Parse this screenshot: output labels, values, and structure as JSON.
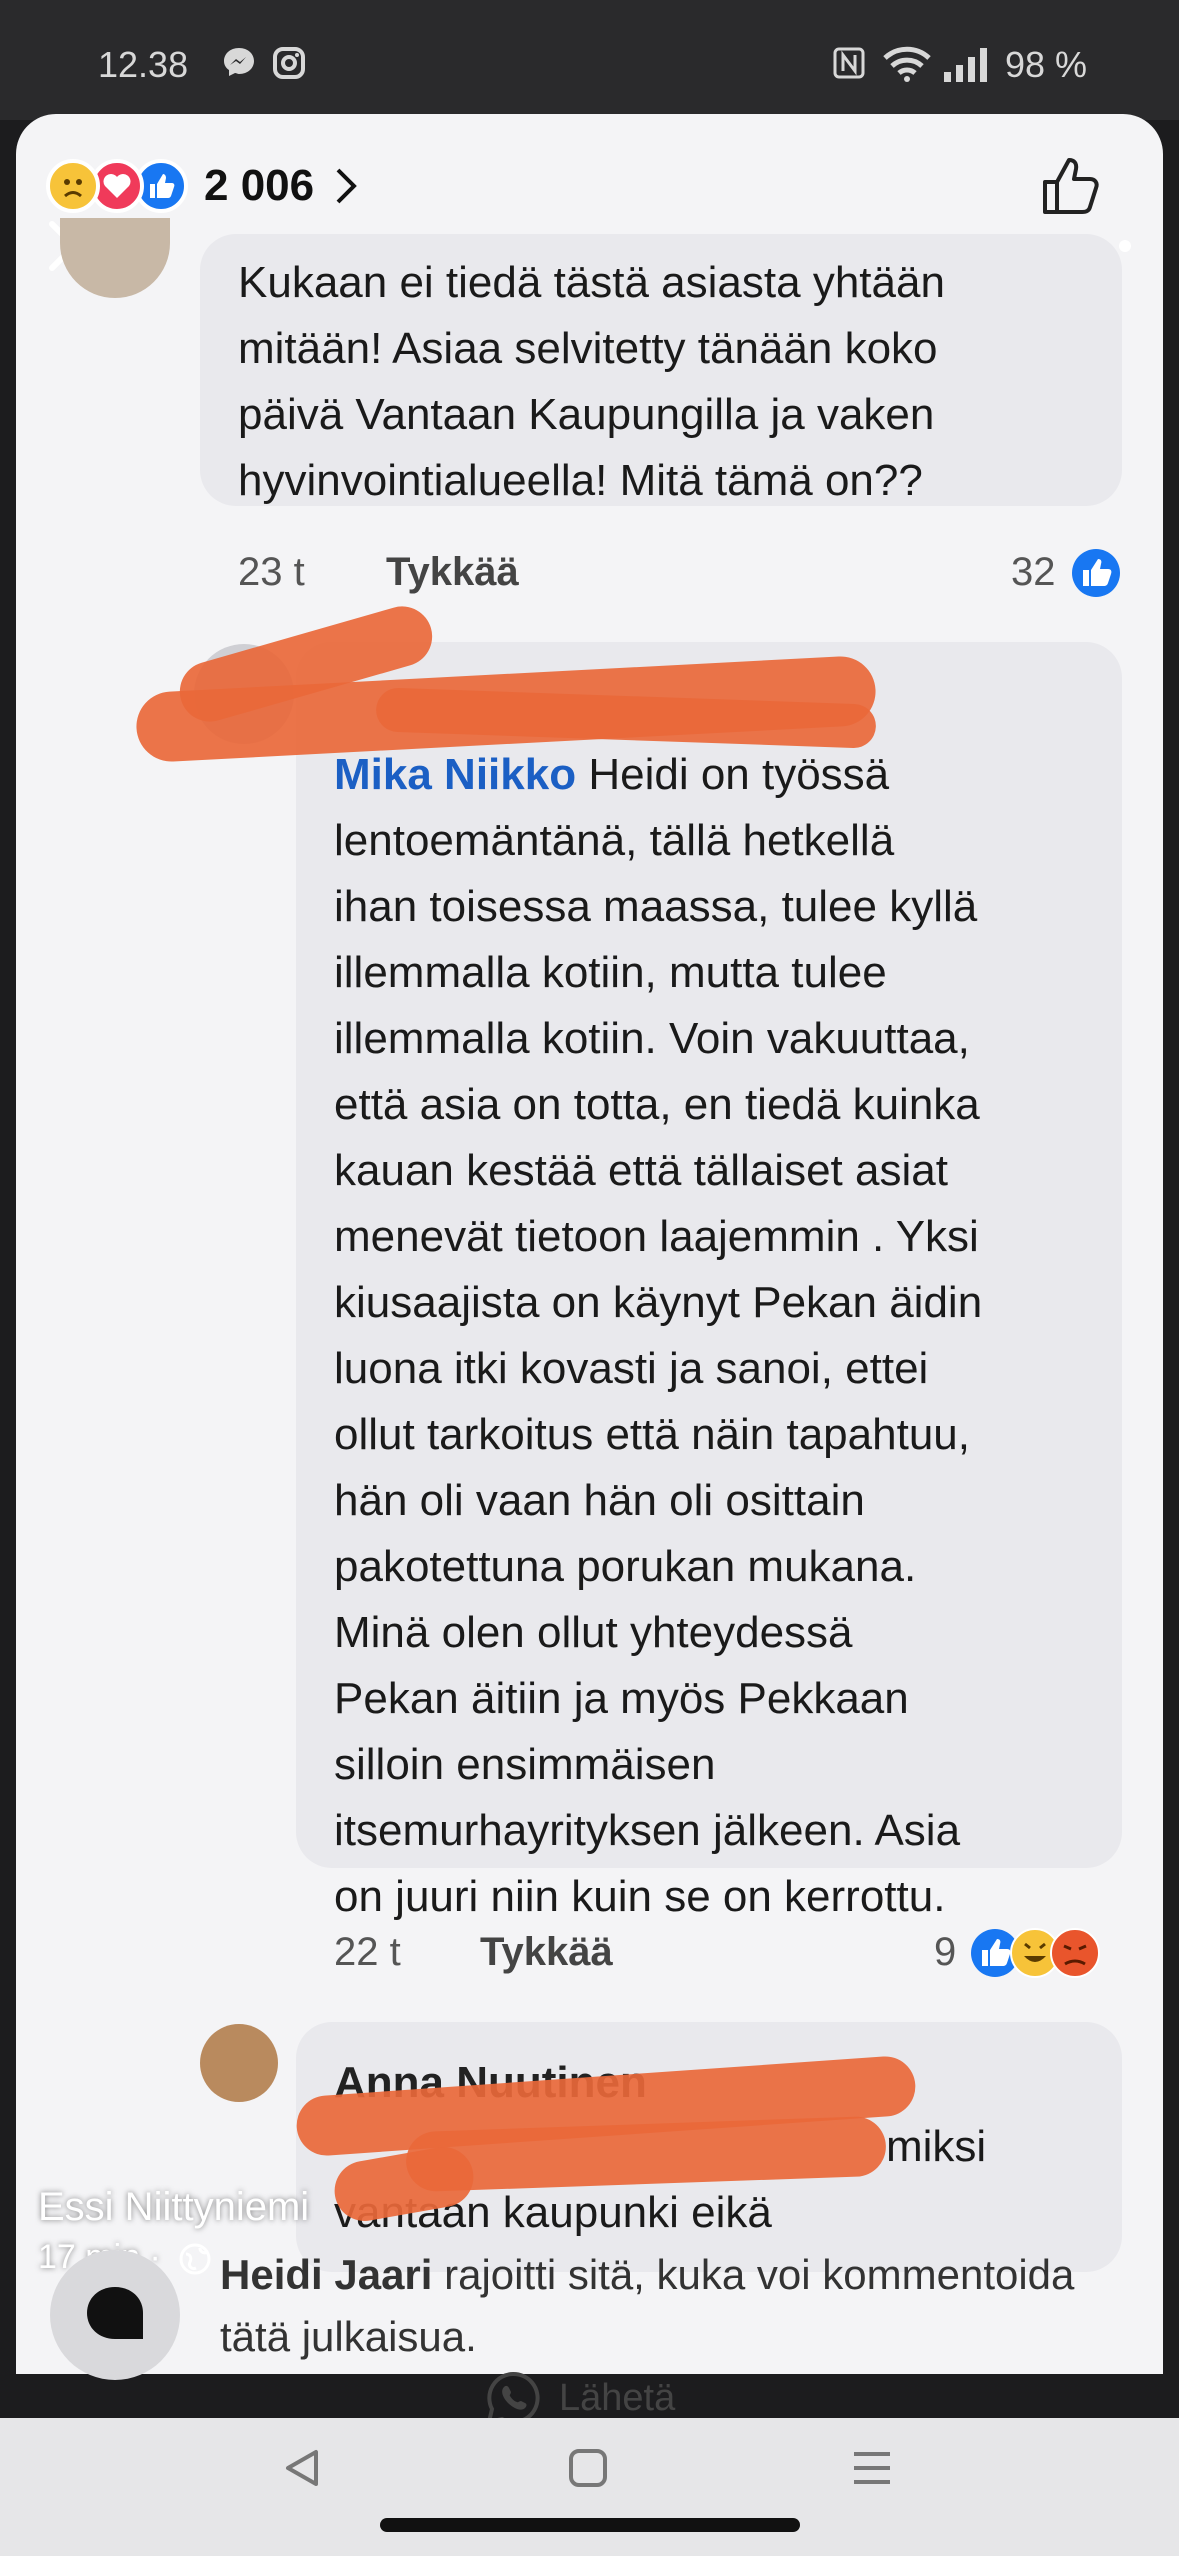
{
  "status": {
    "time": "12.38",
    "battery": "98 %"
  },
  "header": {
    "reaction_count": "2 006"
  },
  "comments": [
    {
      "text": "Kukaan ei tiedä tästä asiasta yhtään\nmitään! Asiaa selvitetty tänään koko\npäivä Vantaan Kaupungilla ja vaken\nhyvinvointialueella! Mitä tämä on??",
      "age": "23 t",
      "like_label": "Tykkää",
      "reactions": "32"
    },
    {
      "mention": "Mika Niikko",
      "text": "Heidi on työssä\nlentoemäntänä, tällä hetkellä\nihan toisessa maassa, tulee kyllä\nillemmalla kotiin, mutta tulee\nillemmalla kotiin. Voin vakuuttaa,\nettä asia on totta, en tiedä kuinka\nkauan kestää että tällaiset asiat\nmenevät tietoon laajemmin . Yksi\nkiusaajista on käynyt Pekan äidin\nluona itki kovasti ja sanoi, ettei\nollut tarkoitus että näin tapahtuu,\nhän oli vaan hän oli osittain\npakotettuna porukan mukana.\nMinä olen ollut yhteydessä\nPekan äitiin ja myös Pekkaan\nsilloin ensimmäisen\nitsemurhayrityksen jälkeen. Asia\non juuri niin kuin se on kerrottu.",
      "age": "22 t",
      "like_label": "Tykkää",
      "reactions": "9"
    },
    {
      "author": "Anna Nuutinen",
      "text_fragment": "miksi",
      "text_line2": "vantaan kaupunki eikä"
    }
  ],
  "overlay": {
    "poster": "Essi Niittyniemi",
    "time": "17 min ·"
  },
  "restriction": {
    "name": "Heidi Jaari",
    "text": "rajoitti sitä, kuka voi kommentoida tätä julkaisua."
  },
  "share": {
    "label": "Lähetä"
  },
  "colors": {
    "accent": "#1877f2",
    "scribble": "#e9683a"
  }
}
